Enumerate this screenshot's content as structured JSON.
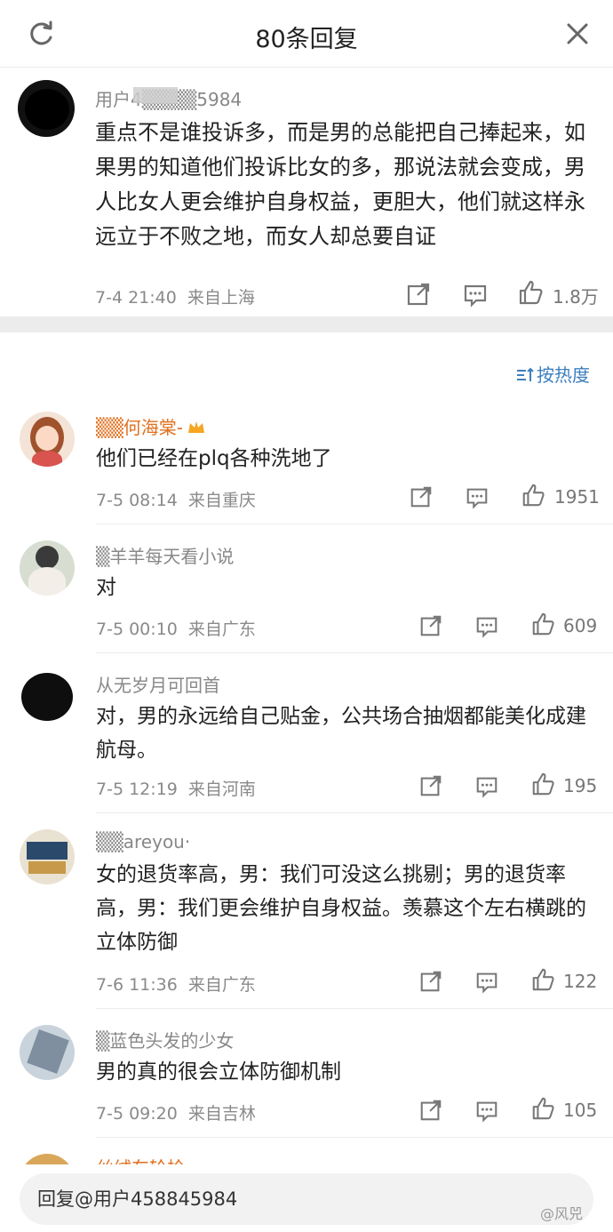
{
  "header": {
    "title": "80条回复"
  },
  "main_comment": {
    "username": "用户4▒▒▒▒5984",
    "text": "重点不是谁投诉多，而是男的总能把自己捧起来，如果男的知道他们投诉比女的多，那说法就会变成，男人比女人更会维护自身权益，更胆大，他们就这样永远立于不败之地，而女人却总要自证",
    "time": "7-4 21:40",
    "location": "来自上海",
    "likes": "1.8万"
  },
  "sort": {
    "label": "按热度"
  },
  "replies": [
    {
      "username": "▒▒何海棠-",
      "text": "他们已经在plq各种洗地了",
      "time": "7-5 08:14",
      "location": "来自重庆",
      "likes": "1951"
    },
    {
      "username": "▒羊羊每天看小说",
      "text": "对",
      "time": "7-5 00:10",
      "location": "来自广东",
      "likes": "609"
    },
    {
      "username": "从无岁月可回首",
      "text": "对，男的永远给自己贴金，公共场合抽烟都能美化成建航母。",
      "time": "7-5 12:19",
      "location": "来自河南",
      "likes": "195"
    },
    {
      "username": "▒▒areyou·",
      "text": "女的退货率高，男：我们可没这么挑剔；男的退货率高，男：我们更会维护自身权益。羡慕这个左右横跳的立体防御",
      "time": "7-6 11:36",
      "location": "来自广东",
      "likes": "122"
    },
    {
      "username": "▒蓝色头发的少女",
      "text": "男的真的很会立体防御机制",
      "time": "7-5 09:20",
      "location": "来自吉林",
      "likes": "105"
    },
    {
      "username": "丝绒车轮桧"
    }
  ],
  "reply_bar": {
    "value": "回复@用户458845984"
  },
  "watermark": "@风兕",
  "colors": {
    "accent": "#3d7fbf",
    "meta_gray": "#8a8a8a",
    "divider": "#ececec"
  }
}
